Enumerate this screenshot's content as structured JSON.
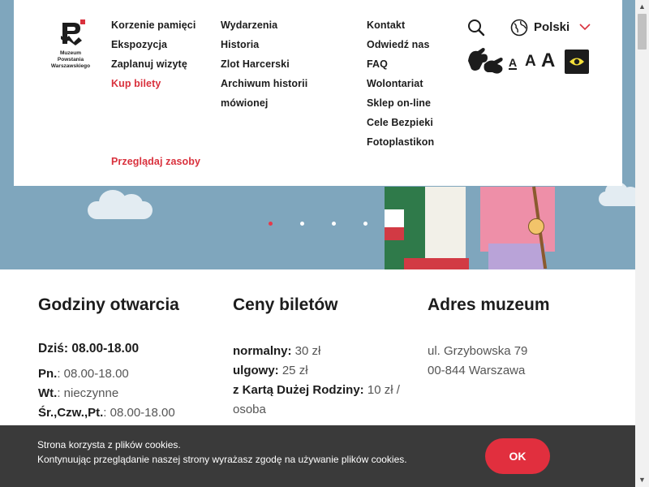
{
  "logo": {
    "line1": "Muzeum",
    "line2": "Powstania",
    "line3": "Warszawskiego"
  },
  "menu": {
    "col1": [
      "Korzenie pamięci",
      "Ekspozycja",
      "Zaplanuj wizytę",
      "Kup bilety"
    ],
    "col1_extra": "Przeglądaj zasoby",
    "col2": [
      "Wydarzenia",
      "Historia",
      "Zlot Harcerski",
      "Archiwum historii",
      "mówionej"
    ],
    "col3": [
      "Kontakt",
      "Odwiedź nas",
      "FAQ",
      "Wolontariat",
      "Sklep on-line",
      "Cele Bezpieki",
      "Fotoplastikon"
    ]
  },
  "tools": {
    "language": "Polski",
    "font_small": "A",
    "font_medium": "A",
    "font_large": "A",
    "icons": [
      "search-icon",
      "globe-icon",
      "chevron-down-icon",
      "sign-language-icon",
      "eye-icon"
    ]
  },
  "colors": {
    "accent": "#d9313d",
    "cookie_bg": "#3a3a3a",
    "ok_button": "#e12f3e",
    "eye": "#f5e03a"
  },
  "slider": {
    "count": 4,
    "active": 1
  },
  "hours": {
    "title": "Godziny otwarcia",
    "today_label": "Dziś: 08.00-18.00",
    "rows": [
      {
        "label": "Pn.",
        "value": ": 08.00-18.00"
      },
      {
        "label": "Wt.",
        "value": ": nieczynne"
      },
      {
        "label": "Śr.,Czw.,Pt.",
        "value": ": 08.00-18.00"
      }
    ]
  },
  "prices": {
    "title": "Ceny biletów",
    "rows": [
      {
        "label": "normalny:",
        "value": " 30 zł"
      },
      {
        "label": "ulgowy:",
        "value": " 25 zł"
      },
      {
        "label": "z Kartą Dużej Rodziny:",
        "value": " 10 zł /"
      }
    ],
    "continuation": "osoba"
  },
  "address": {
    "title": "Adres muzeum",
    "line1": "ul. Grzybowska 79",
    "line2": "00-844 Warszawa"
  },
  "cookie": {
    "line1": "Strona korzysta z plików cookies.",
    "line2": "Kontynuując przeglądanie naszej strony wyrażasz zgodę na używanie plików cookies.",
    "ok": "OK"
  }
}
